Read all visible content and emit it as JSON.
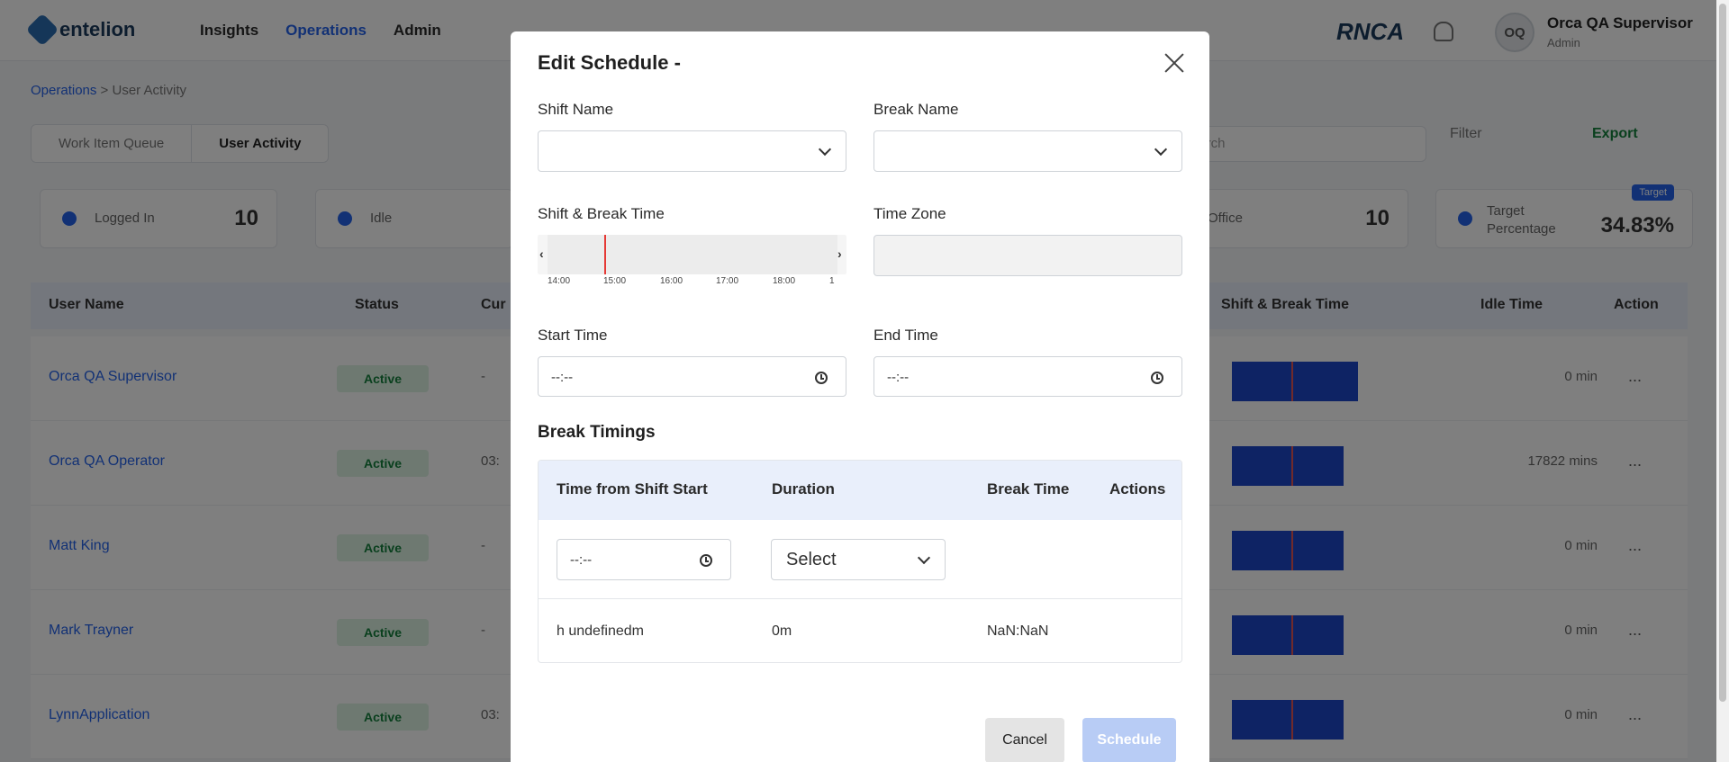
{
  "app": {
    "brand": "entelion",
    "nav": [
      "Insights",
      "Operations",
      "Admin"
    ],
    "right_brand": "RNCA",
    "user_initials": "OQ",
    "user_name": "Orca QA Supervisor",
    "user_role": "Admin"
  },
  "breadcrumb": {
    "root": "Operations",
    "separator": ">",
    "current": "User Activity"
  },
  "tabs": [
    "Work Item Queue",
    "User Activity"
  ],
  "search": {
    "placeholder": "Search"
  },
  "filter_label": "Filter",
  "export_label": "Export",
  "stats": {
    "logged_in": {
      "label": "Logged In",
      "value": "10"
    },
    "idle": {
      "label": "Idle",
      "value": ""
    },
    "office": {
      "label": "Office",
      "value": "10"
    },
    "target": {
      "label": "Target Percentage",
      "value": "34.83%",
      "badge": "Target"
    }
  },
  "table": {
    "headers": [
      "User Name",
      "Status",
      "Cur",
      "Shift & Break Time",
      "Idle Time",
      "Action"
    ],
    "rows": [
      {
        "name": "Orca QA Supervisor",
        "status": "Active",
        "current": "-",
        "duration": "0 min",
        "action": "..."
      },
      {
        "name": "Orca QA Operator",
        "status": "Active",
        "current": "03:",
        "duration": "17822 mins",
        "action": "..."
      },
      {
        "name": "Matt King",
        "status": "Active",
        "current": "-",
        "duration": "0 min",
        "action": "..."
      },
      {
        "name": "Mark Trayner",
        "status": "Active",
        "current": "-",
        "duration": "0 min",
        "action": "..."
      },
      {
        "name": "LynnApplication",
        "status": "Active",
        "current": "03:",
        "duration": "0 min",
        "action": "..."
      }
    ]
  },
  "modal": {
    "title": "Edit Schedule -",
    "shift_name_label": "Shift Name",
    "break_name_label": "Break Name",
    "shift_break_time_label": "Shift & Break Time",
    "time_zone_label": "Time Zone",
    "timeline_ticks": [
      "14:00",
      "15:00",
      "16:00",
      "17:00",
      "18:00",
      "1"
    ],
    "start_time_label": "Start Time",
    "end_time_label": "End Time",
    "start_time_value": "--:--",
    "end_time_value": "--:--",
    "break_timings_title": "Break Timings",
    "break_table": {
      "headers": [
        "Time from Shift Start",
        "Duration",
        "Break Time",
        "Actions"
      ],
      "input_row": {
        "time_value": "--:--",
        "duration_value": "Select"
      },
      "data_row": {
        "time_from_start": "h undefinedm",
        "duration": "0m",
        "break_time": "NaN:NaN"
      }
    },
    "cancel_label": "Cancel",
    "schedule_label": "Schedule"
  },
  "colors": {
    "accent": "#2563eb",
    "overlay": "rgba(0,0,0,0.5)",
    "current_time_marker": "#e53935",
    "schedule_disabled": "#b8ccf5"
  }
}
